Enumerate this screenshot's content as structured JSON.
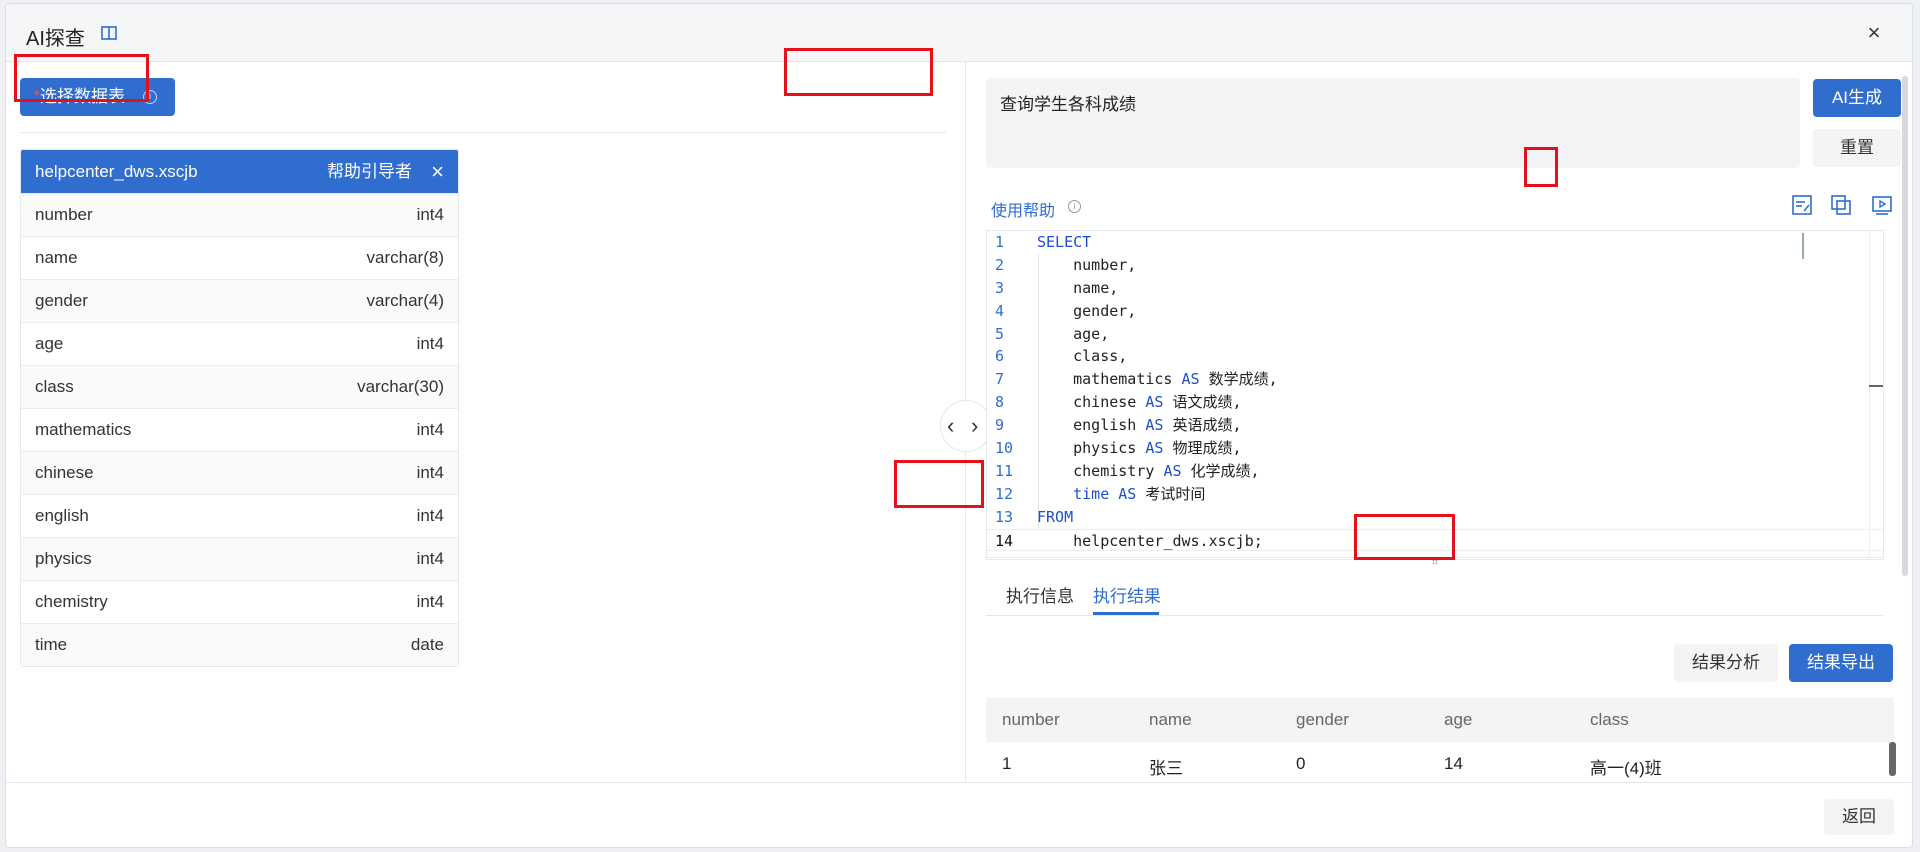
{
  "dialog": {
    "title": "AI探查",
    "back_label": "返回"
  },
  "left": {
    "select_table_label": "选择数据表",
    "table": {
      "name": "helpcenter_dws.xscjb",
      "owner": "帮助引导者",
      "columns": [
        {
          "name": "number",
          "type": "int4"
        },
        {
          "name": "name",
          "type": "varchar(8)"
        },
        {
          "name": "gender",
          "type": "varchar(4)"
        },
        {
          "name": "age",
          "type": "int4"
        },
        {
          "name": "class",
          "type": "varchar(30)"
        },
        {
          "name": "mathematics",
          "type": "int4"
        },
        {
          "name": "chinese",
          "type": "int4"
        },
        {
          "name": "english",
          "type": "int4"
        },
        {
          "name": "physics",
          "type": "int4"
        },
        {
          "name": "chemistry",
          "type": "int4"
        },
        {
          "name": "time",
          "type": "date"
        }
      ]
    }
  },
  "right": {
    "query_text": "查询学生各科成绩",
    "ai_generate_label": "AI生成",
    "reset_label": "重置",
    "help_label": "使用帮助",
    "sql_lines": [
      {
        "n": "1",
        "code": "SELECT"
      },
      {
        "n": "2",
        "code": "    number,"
      },
      {
        "n": "3",
        "code": "    name,"
      },
      {
        "n": "4",
        "code": "    gender,"
      },
      {
        "n": "5",
        "code": "    age,"
      },
      {
        "n": "6",
        "code": "    class,"
      },
      {
        "n": "7",
        "code": "    mathematics AS 数学成绩,"
      },
      {
        "n": "8",
        "code": "    chinese AS 语文成绩,"
      },
      {
        "n": "9",
        "code": "    english AS 英语成绩,"
      },
      {
        "n": "10",
        "code": "    physics AS 物理成绩,"
      },
      {
        "n": "11",
        "code": "    chemistry AS 化学成绩,"
      },
      {
        "n": "12",
        "code": "    time AS 考试时间"
      },
      {
        "n": "13",
        "code": "FROM"
      },
      {
        "n": "14",
        "code": "    helpcenter_dws.xscjb;"
      }
    ],
    "tabs": [
      "执行信息",
      "执行结果"
    ],
    "analyze_label": "结果分析",
    "export_label": "结果导出",
    "result_headers": [
      "number",
      "name",
      "gender",
      "age",
      "class"
    ],
    "result_rows": [
      [
        "1",
        "张三",
        "0",
        "14",
        "高一(4)班"
      ]
    ]
  },
  "colors": {
    "primary": "#2f6ecf",
    "highlight": "#e5101a"
  }
}
